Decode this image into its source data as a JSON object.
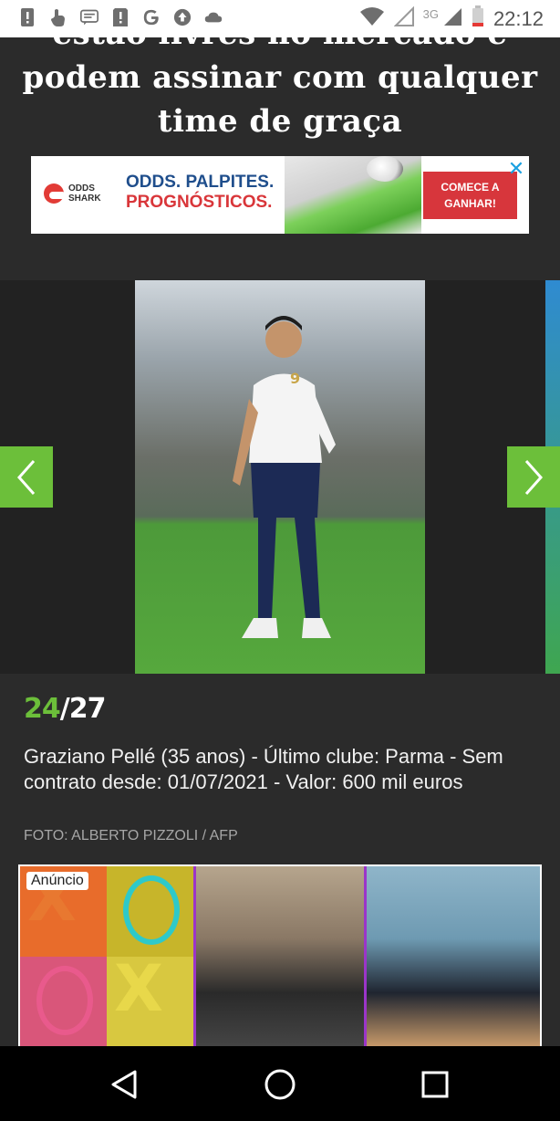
{
  "status_bar": {
    "time": "22:12",
    "network": "3G",
    "icons": [
      "alert-icon",
      "touch-icon",
      "message-icon",
      "alert-icon",
      "google-icon",
      "navigation-icon",
      "cloud-icon",
      "wifi-icon",
      "signal-icon",
      "signal-icon",
      "battery-icon"
    ]
  },
  "article": {
    "headline_line1": "estão livres no mercado e",
    "headline_line2": "podem assinar com qualquer",
    "headline_line3": "time de graça"
  },
  "ad_banner": {
    "brand_line1": "ODDS",
    "brand_line2": "SHARK",
    "headline_line1": "ODDS. PALPITES.",
    "headline_line2": "PROGNÓSTICOS.",
    "cta_line1": "COMECE A",
    "cta_line2": "GANHAR!",
    "close_icon": "✕"
  },
  "gallery": {
    "current": "24",
    "separator": "/",
    "total": "27",
    "caption": "Graziano Pellé (35 anos) - Último clube: Parma - Sem contrato desde: 01/07/2021 - Valor: 600 mil euros",
    "credit": "FOTO: ALBERTO PIZZOLI / AFP",
    "player_number": "9"
  },
  "ad2": {
    "label": "Anúncio"
  },
  "colors": {
    "accent": "#6cbf3a",
    "page_background": "#2b2b2b",
    "ad_red": "#d7363c",
    "ad_blue": "#1f4e8c"
  }
}
